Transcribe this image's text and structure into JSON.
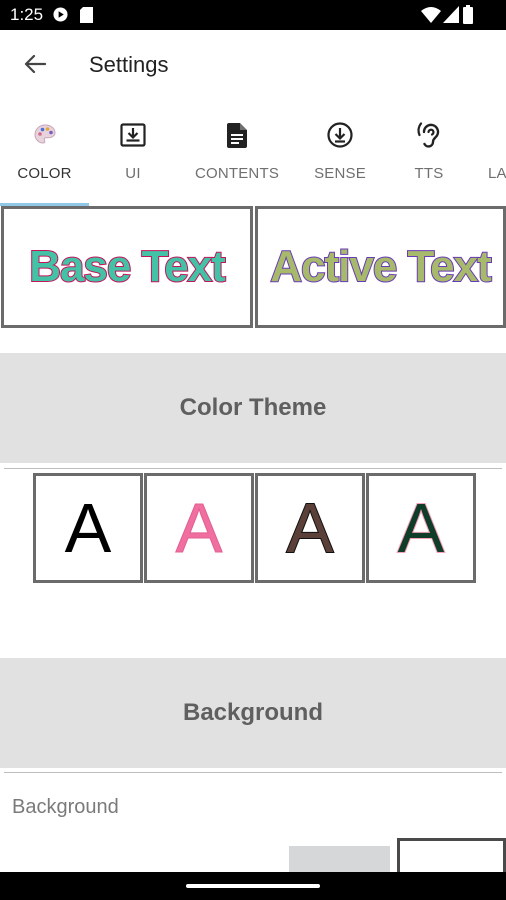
{
  "status_bar": {
    "time": "1:25",
    "icons": [
      "media-play-icon",
      "sd-card-icon",
      "wifi-icon",
      "signal-icon",
      "battery-icon"
    ]
  },
  "app_bar": {
    "title": "Settings",
    "back_icon": "arrow-back-icon"
  },
  "tabs": [
    {
      "label": "COLOR",
      "icon": "palette-icon",
      "active": true
    },
    {
      "label": "UI",
      "icon": "download-box-icon",
      "active": false
    },
    {
      "label": "CONTENTS",
      "icon": "document-icon",
      "active": false
    },
    {
      "label": "SENSE",
      "icon": "download-circle-icon",
      "active": false
    },
    {
      "label": "TTS",
      "icon": "hearing-icon",
      "active": false
    },
    {
      "label": "LA",
      "icon": "",
      "active": false
    }
  ],
  "preview": {
    "base_text": "Base Text",
    "active_text": "Active Text",
    "colors": {
      "base_fill": "#44c2a6",
      "base_outline": "#c3155c",
      "active_fill": "#a7b96a",
      "active_outline": "#6a3bb6"
    }
  },
  "sections": {
    "color_theme": "Color Theme",
    "background": "Background"
  },
  "color_themes": [
    {
      "letter": "A",
      "fill": "#000000",
      "outline": "#000000"
    },
    {
      "letter": "A",
      "fill": "#f06ea0",
      "outline": "#e06090"
    },
    {
      "letter": "A",
      "fill": "#5a4038",
      "outline": "#111111"
    },
    {
      "letter": "A",
      "fill": "#0f3d2a",
      "outline": "#f4a0b8"
    }
  ],
  "background_setting": {
    "label": "Background",
    "swatches": [
      "#d6d7d8",
      "#ffffff"
    ]
  }
}
